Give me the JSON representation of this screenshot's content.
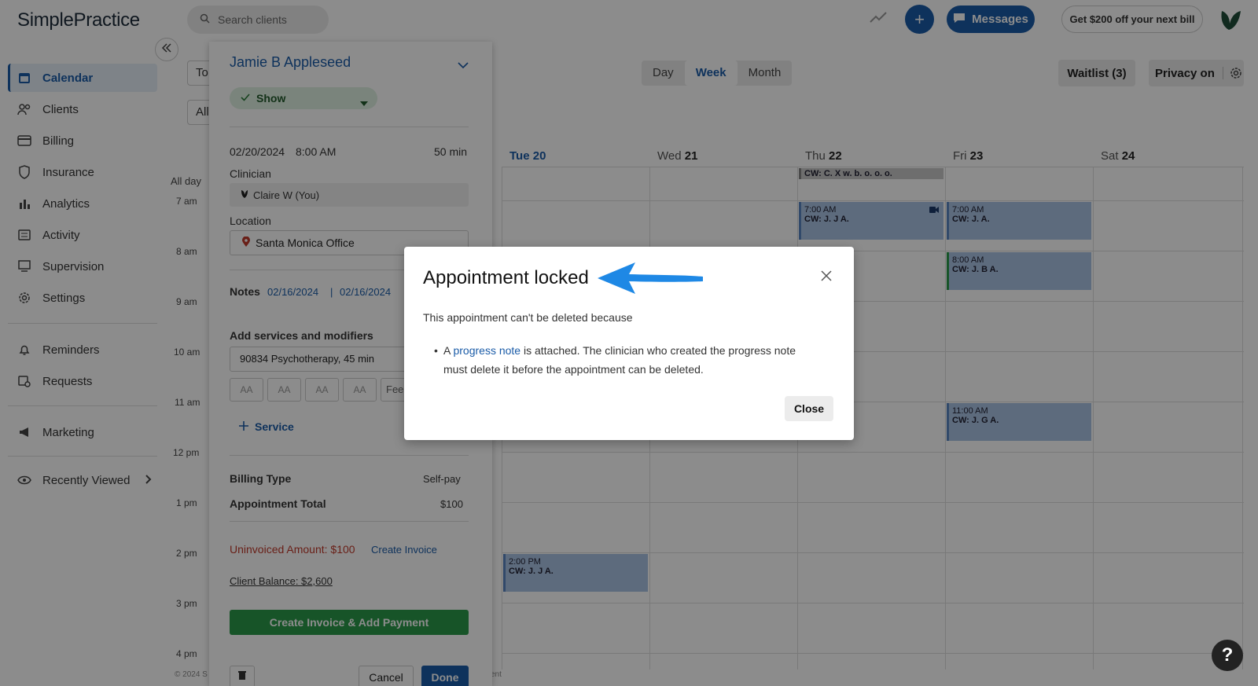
{
  "app": {
    "logo": "SimplePractice"
  },
  "sidebar": {
    "items": [
      {
        "label": "Calendar",
        "icon": "calendar-icon"
      },
      {
        "label": "Clients",
        "icon": "clients-icon"
      },
      {
        "label": "Billing",
        "icon": "billing-icon"
      },
      {
        "label": "Insurance",
        "icon": "shield-icon"
      },
      {
        "label": "Analytics",
        "icon": "analytics-icon"
      },
      {
        "label": "Activity",
        "icon": "activity-icon"
      },
      {
        "label": "Supervision",
        "icon": "supervision-icon"
      },
      {
        "label": "Settings",
        "icon": "gear-icon"
      },
      {
        "label": "Reminders",
        "icon": "bell-icon"
      },
      {
        "label": "Requests",
        "icon": "requests-icon"
      },
      {
        "label": "Marketing",
        "icon": "megaphone-icon"
      },
      {
        "label": "Recently Viewed",
        "icon": "eye-icon"
      }
    ]
  },
  "topbar": {
    "search_placeholder": "Search clients",
    "messages_label": "Messages",
    "promo_label": "Get $200 off your next bill",
    "plus_label": "+"
  },
  "calendar": {
    "view_options": [
      "Day",
      "Week",
      "Month"
    ],
    "selected_view": "Week",
    "waitlist_label": "Waitlist (3)",
    "privacy_label": "Privacy on",
    "stub_today": "To",
    "stub_all": "All",
    "allday_label": "All day",
    "days": [
      {
        "dow": "Tue",
        "num": "20"
      },
      {
        "dow": "Wed",
        "num": "21"
      },
      {
        "dow": "Thu",
        "num": "22"
      },
      {
        "dow": "Fri",
        "num": "23"
      },
      {
        "dow": "Sat",
        "num": "24"
      }
    ],
    "times": [
      "7 am",
      "8 am",
      "9 am",
      "10 am",
      "11 am",
      "12 pm",
      "1 pm",
      "2 pm",
      "3 pm",
      "4 pm"
    ],
    "appointments": [
      {
        "time": "",
        "name": "CW: C. X w. b. o. o. o."
      },
      {
        "time": "7:00 AM",
        "name": "CW: J. J A."
      },
      {
        "time": "7:00 AM",
        "name": "CW: J. A."
      },
      {
        "time": "8:00 AM",
        "name": "CW: J. B A."
      },
      {
        "time": "11:00 AM",
        "name": "CW: J. G A."
      },
      {
        "time": "2:00 PM",
        "name": "CW: J. J A."
      }
    ]
  },
  "panel": {
    "client_name": "Jamie B Appleseed",
    "status": "Show",
    "date": "02/20/2024",
    "time": "8:00 AM",
    "duration": "50 min",
    "clinician_label": "Clinician",
    "clinician_value": "Claire W (You)",
    "location_label": "Location",
    "location_value": "Santa Monica Office",
    "notes_label": "Notes",
    "note_date_1": "02/16/2024",
    "note_sep": "|",
    "note_date_2": "02/16/2024",
    "services_label": "Add services and modifiers",
    "service_value": "90834 Psychotherapy, 45 min",
    "modifier_placeholder": "AA",
    "fee_placeholder": "Fee",
    "add_service": "Service",
    "billing_type_label": "Billing Type",
    "billing_type_value": "Self-pay",
    "total_label": "Appointment Total",
    "total_value": "$100",
    "uninvoiced": "Uninvoiced Amount: $100",
    "create_invoice": "Create Invoice",
    "client_balance": "Client Balance: $2,600",
    "primary_button": "Create Invoice & Add Payment",
    "cancel_label": "Cancel",
    "done_label": "Done"
  },
  "modal": {
    "title": "Appointment locked",
    "body": "This appointment can't be deleted because",
    "bullet_prefix": "A ",
    "bullet_link": "progress note",
    "bullet_suffix": " is attached. The clinician who created the progress note must delete it before the appointment can be deleted.",
    "close_label": "Close"
  },
  "footer": {
    "left": "© 2024 S",
    "right": "ent"
  },
  "help_label": "?",
  "colors": {
    "brand": "#1b5ca8",
    "danger": "#c0392b",
    "success": "#2a9a4a",
    "arrow": "#1e88e5"
  }
}
